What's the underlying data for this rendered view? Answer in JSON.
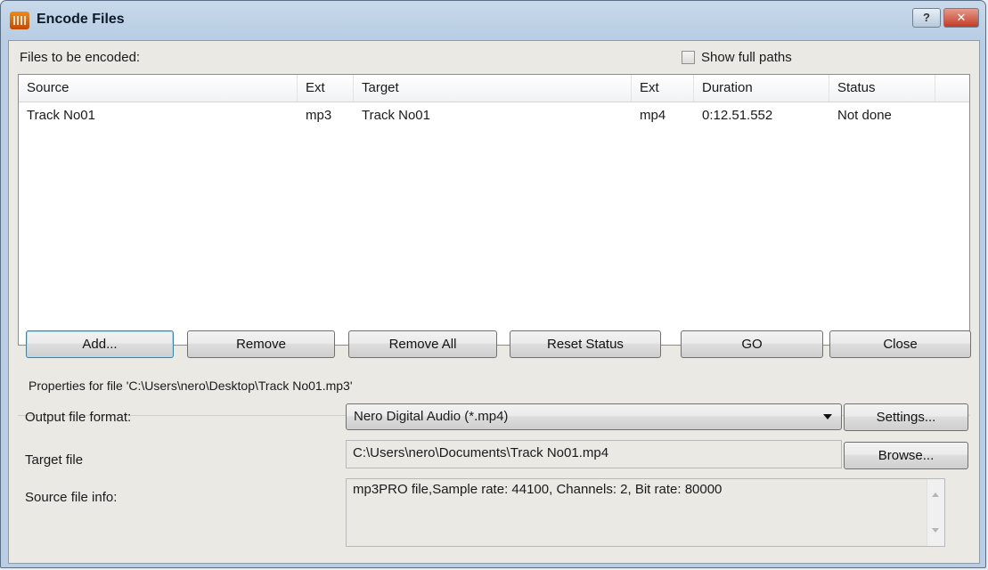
{
  "window": {
    "title": "Encode Files",
    "help_button": "?",
    "close_button": "✕"
  },
  "files_label": "Files to be encoded:",
  "show_full_paths": {
    "label": "Show full paths",
    "checked": false
  },
  "list": {
    "columns": [
      "Source",
      "Ext",
      "Target",
      "Ext",
      "Duration",
      "Status"
    ],
    "rows": [
      {
        "source": "Track No01",
        "ext": "mp3",
        "target": "Track No01",
        "target_ext": "mp4",
        "duration": "0:12.51.552",
        "status": "Not done"
      }
    ]
  },
  "buttons": {
    "add": "Add...",
    "remove": "Remove",
    "remove_all": "Remove All",
    "reset_status": "Reset Status",
    "go": "GO",
    "close": "Close",
    "settings": "Settings...",
    "browse": "Browse..."
  },
  "properties_label": "Properties for file 'C:\\Users\\nero\\Desktop\\Track No01.mp3'",
  "output_format": {
    "label": "Output file format:",
    "value": "Nero Digital Audio (*.mp4)"
  },
  "target_file": {
    "label": "Target file",
    "value": "C:\\Users\\nero\\Documents\\Track No01.mp4"
  },
  "source_info": {
    "label": "Source file info:",
    "value": "mp3PRO file,Sample rate: 44100, Channels: 2, Bit rate: 80000"
  },
  "icons": {
    "app": "nero-app-icon",
    "dropdown": "chevron-down-icon",
    "scroll_up": "scroll-up-icon",
    "scroll_down": "scroll-down-icon"
  }
}
